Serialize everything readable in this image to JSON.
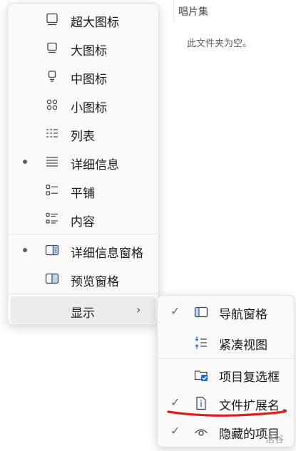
{
  "background": {
    "column_header": "唱片集",
    "empty_message": "此文件夹为空。"
  },
  "view_menu": {
    "items": [
      {
        "label": "超大图标",
        "icon": "extra-large-icons-icon",
        "selected": false
      },
      {
        "label": "大图标",
        "icon": "large-icons-icon",
        "selected": false
      },
      {
        "label": "中图标",
        "icon": "medium-icons-icon",
        "selected": false
      },
      {
        "label": "小图标",
        "icon": "small-icons-icon",
        "selected": false
      },
      {
        "label": "列表",
        "icon": "list-icon",
        "selected": false
      },
      {
        "label": "详细信息",
        "icon": "details-icon",
        "selected": true
      },
      {
        "label": "平铺",
        "icon": "tiles-icon",
        "selected": false
      },
      {
        "label": "内容",
        "icon": "content-icon",
        "selected": false
      }
    ],
    "pane_items": [
      {
        "label": "详细信息窗格",
        "icon": "details-pane-icon",
        "selected": true
      },
      {
        "label": "预览窗格",
        "icon": "preview-pane-icon",
        "selected": false
      }
    ],
    "show_label": "显示",
    "show_chevron": "›"
  },
  "show_submenu": {
    "items": [
      {
        "label": "导航窗格",
        "icon": "navigation-pane-icon",
        "checked": true
      },
      {
        "label": "紧凑视图",
        "icon": "compact-view-icon",
        "checked": false
      },
      {
        "label": "项目复选框",
        "icon": "item-checkbox-icon",
        "checked": false
      },
      {
        "label": "文件扩展名",
        "icon": "file-extension-icon",
        "checked": true
      },
      {
        "label": "隐藏的项目",
        "icon": "hidden-items-icon",
        "checked": true
      }
    ],
    "check_glyph": "✓"
  },
  "annotation": {
    "underline_color": "#e01e1e"
  },
  "watermark": "活谷"
}
